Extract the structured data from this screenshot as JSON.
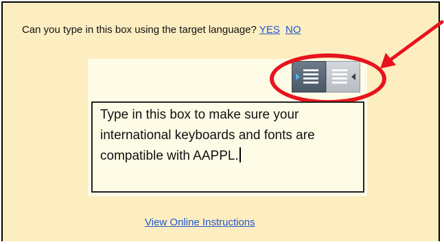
{
  "prompt": {
    "question": "Can you type in this box using the target language?",
    "yes_label": "YES",
    "no_label": "NO"
  },
  "direction_toggle": {
    "ltr_icon": "align-left-ltr-icon",
    "rtl_icon": "align-right-rtl-icon"
  },
  "test_box": {
    "text": "Type in this box to make sure your international keyboards and fonts are compatible with AAPPL."
  },
  "footer": {
    "instructions_link": "View Online Instructions"
  },
  "annotations": {
    "highlight_color": "#e8141d"
  },
  "colors": {
    "panel_background": "#fdeec1",
    "link": "#2255cc"
  }
}
